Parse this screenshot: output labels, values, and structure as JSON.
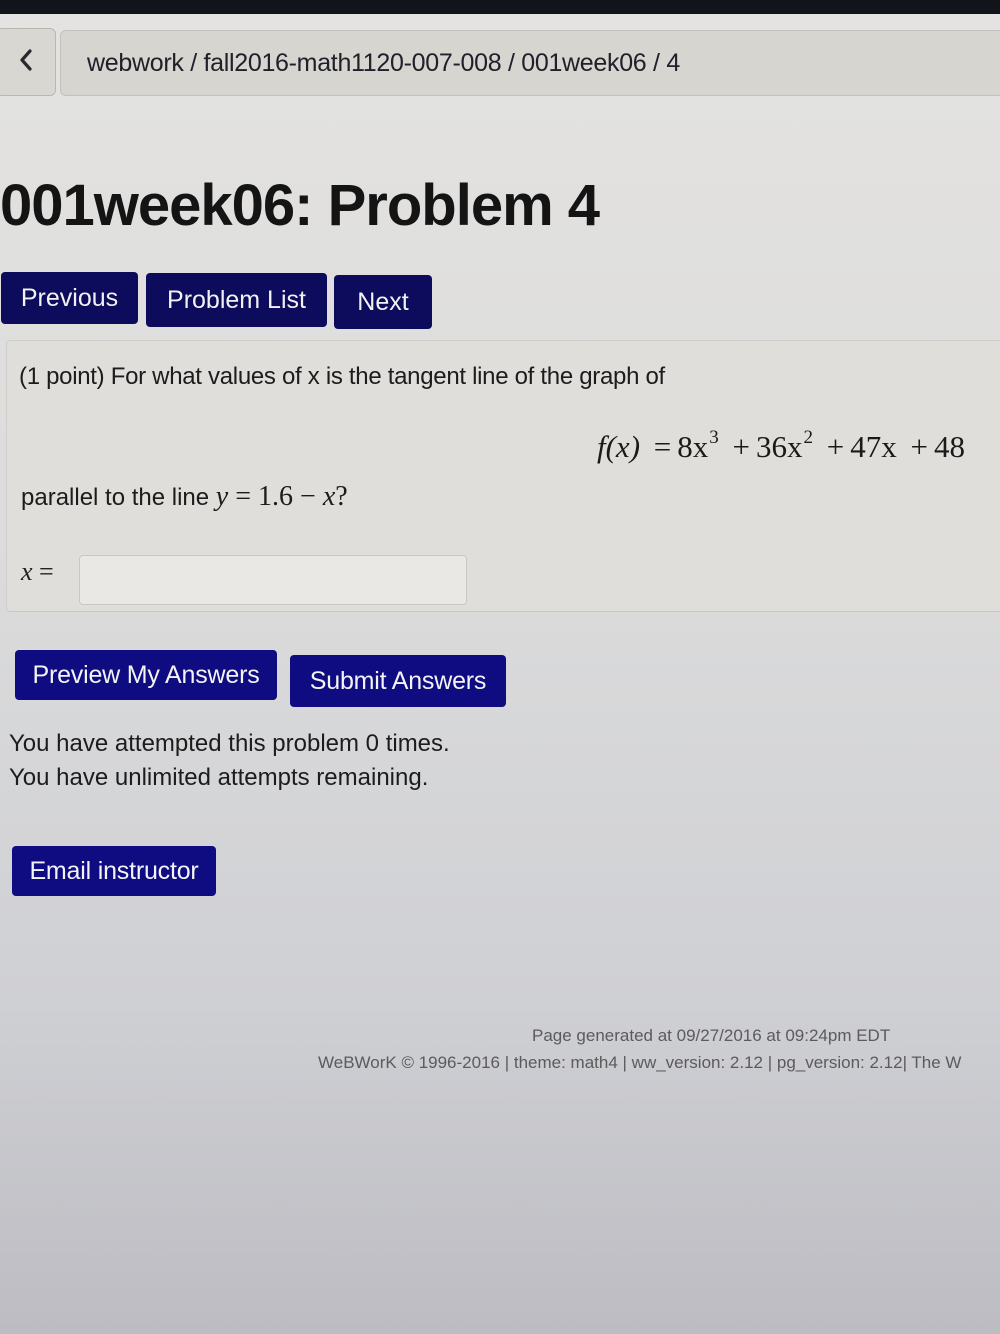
{
  "breadcrumb": {
    "back_icon": "chevron-left-icon",
    "path": "webwork / fall2016-math1120-007-008 / 001week06 / 4"
  },
  "page": {
    "title": "001week06: Problem 4"
  },
  "nav": {
    "previous_label": "Previous",
    "problem_list_label": "Problem List",
    "next_label": "Next"
  },
  "problem": {
    "intro": "(1 point) For what values of x is the tangent line of the graph of",
    "formula": {
      "lhs": "f(x)",
      "equals": "=",
      "term1_coef": "8x",
      "term1_exp": "3",
      "plus1": "+",
      "term2_coef": "36x",
      "term2_exp": "2",
      "plus2": "+",
      "term3": "47x",
      "plus3": "+",
      "term4": "48"
    },
    "parallel_prefix": "parallel to the line ",
    "parallel_math": {
      "y": "y",
      "rest": " = 1.6 − ",
      "x": "x",
      "suffix": "?"
    },
    "answer_label_var": "x",
    "answer_label_eq": " =",
    "answer_value": "",
    "answer_placeholder": ""
  },
  "actions": {
    "preview_label": "Preview My Answers",
    "submit_label": "Submit Answers"
  },
  "status": {
    "attempts_line": "You have attempted this problem 0 times.",
    "remaining_line": "You have unlimited attempts remaining."
  },
  "email": {
    "label": "Email instructor"
  },
  "footer": {
    "generated": "Page generated at 09/27/2016 at 09:24pm EDT",
    "info": "WeBWorK © 1996-2016 | theme: math4 | ww_version: 2.12 | pg_version: 2.12| The W"
  },
  "colors": {
    "button_nav": "#0d0b5c",
    "button_action": "#0e0c80",
    "page_bg": "#dedddb"
  }
}
